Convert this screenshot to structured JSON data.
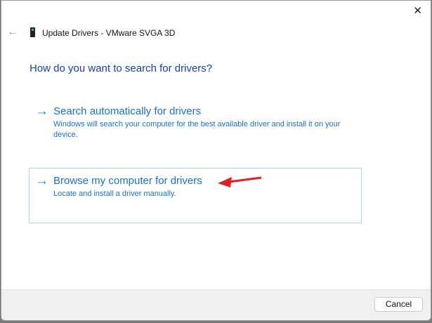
{
  "window": {
    "title": "Update Drivers - VMware SVGA 3D",
    "close_icon": "✕",
    "back_icon": "←"
  },
  "heading": "How do you want to search for drivers?",
  "options": [
    {
      "label": "Search automatically for drivers",
      "description": "Windows will search your computer for the best available driver and install it on your device.",
      "arrow": "→"
    },
    {
      "label": "Browse my computer for drivers",
      "description": "Locate and install a driver manually.",
      "arrow": "→"
    }
  ],
  "footer": {
    "cancel_label": "Cancel"
  },
  "colors": {
    "accent": "#1a70c8",
    "annotation": "#e02020"
  }
}
